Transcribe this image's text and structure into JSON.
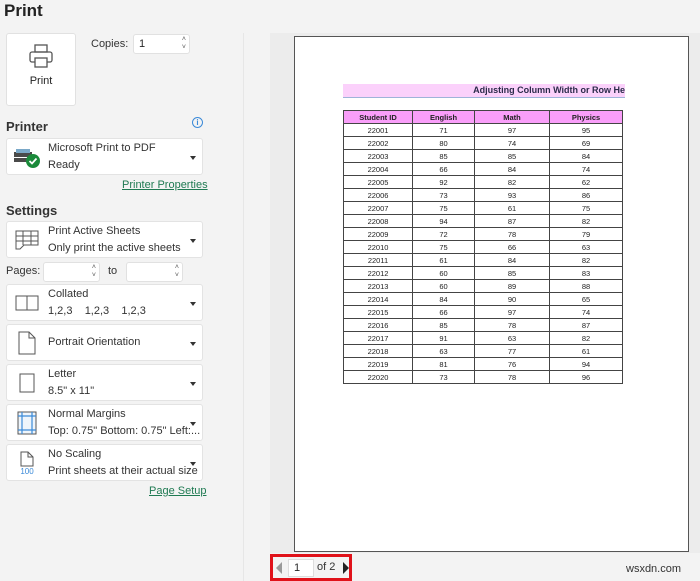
{
  "header": {
    "title": "Print"
  },
  "print_button": {
    "label": "Print"
  },
  "copies": {
    "label": "Copies:",
    "value": "1"
  },
  "printer": {
    "section_label": "Printer",
    "name": "Microsoft Print to PDF",
    "status": "Ready",
    "properties_link": "Printer Properties"
  },
  "settings": {
    "section_label": "Settings",
    "print_what": {
      "title": "Print Active Sheets",
      "subtitle": "Only print the active sheets"
    },
    "pages": {
      "label": "Pages:",
      "from": "",
      "to_label": "to",
      "to": ""
    },
    "collation": {
      "title": "Collated",
      "subtitle": "1,2,3    1,2,3    1,2,3"
    },
    "orientation": {
      "title": "Portrait Orientation"
    },
    "paper": {
      "title": "Letter",
      "subtitle": "8.5\" x 11\""
    },
    "margins": {
      "title": "Normal Margins",
      "subtitle": "Top: 0.75\" Bottom: 0.75\" Left:..."
    },
    "scaling": {
      "title": "No Scaling",
      "subtitle": "Print sheets at their actual size",
      "icon_text": "100"
    },
    "page_setup_link": "Page Setup"
  },
  "preview": {
    "sheet_title": "Adjusting Column Width or Row He",
    "columns": [
      "Student ID",
      "English",
      "Math",
      "Physics"
    ],
    "rows": [
      [
        "22001",
        "71",
        "97",
        "95"
      ],
      [
        "22002",
        "80",
        "74",
        "69"
      ],
      [
        "22003",
        "85",
        "85",
        "84"
      ],
      [
        "22004",
        "66",
        "84",
        "74"
      ],
      [
        "22005",
        "92",
        "82",
        "62"
      ],
      [
        "22006",
        "73",
        "93",
        "86"
      ],
      [
        "22007",
        "75",
        "61",
        "75"
      ],
      [
        "22008",
        "94",
        "87",
        "82"
      ],
      [
        "22009",
        "72",
        "78",
        "79"
      ],
      [
        "22010",
        "75",
        "66",
        "63"
      ],
      [
        "22011",
        "61",
        "84",
        "82"
      ],
      [
        "22012",
        "60",
        "85",
        "83"
      ],
      [
        "22013",
        "60",
        "89",
        "88"
      ],
      [
        "22014",
        "84",
        "90",
        "65"
      ],
      [
        "22015",
        "66",
        "97",
        "74"
      ],
      [
        "22016",
        "85",
        "78",
        "87"
      ],
      [
        "22017",
        "91",
        "63",
        "82"
      ],
      [
        "22018",
        "63",
        "77",
        "61"
      ],
      [
        "22019",
        "81",
        "76",
        "94"
      ],
      [
        "22020",
        "73",
        "78",
        "96"
      ]
    ]
  },
  "pager": {
    "current": "1",
    "of_label": "of 2"
  },
  "watermark": "wsxdn.com",
  "colors": {
    "link": "#1f7a52",
    "header_fill": "#f99ef9",
    "title_fill": "#fbd1fb",
    "highlight": "#e0121a"
  }
}
